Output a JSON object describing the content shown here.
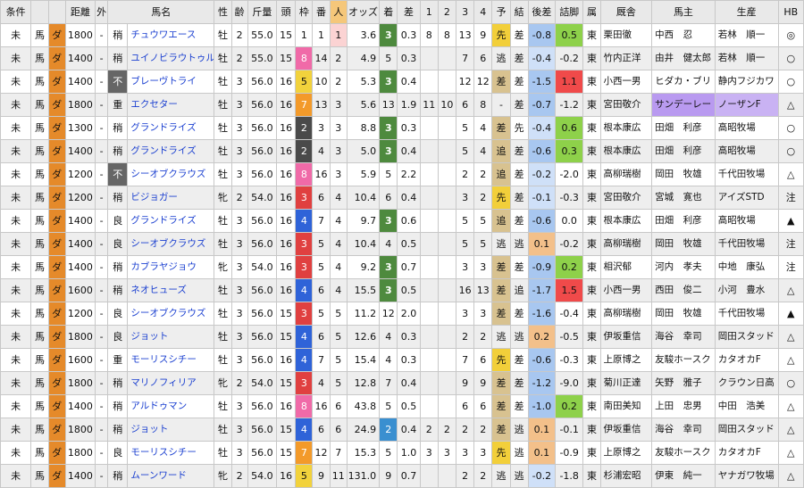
{
  "headers": [
    "条件",
    "",
    "",
    "距離",
    "外",
    "馬名",
    "性",
    "齢",
    "斤量",
    "頭",
    "枠",
    "番",
    "人",
    "オッズ",
    "着",
    "差",
    "1",
    "2",
    "3",
    "4",
    "予",
    "結",
    "後差",
    "詰脚",
    "属",
    "厩舎",
    "馬主",
    "生産",
    "HB"
  ],
  "rows": [
    [
      "未",
      "馬",
      "ダ",
      "1800",
      "-",
      "稍",
      "チュウワエース",
      "牡",
      "2",
      "55.0",
      "15",
      "1",
      "1",
      "1",
      "3.6",
      "3",
      "0.3",
      "8",
      "8",
      "13",
      "9",
      "先",
      "差",
      "-0.8",
      "0.5",
      "東",
      "栗田徹",
      "中西　忍",
      "若林　順一",
      "◎"
    ],
    [
      "未",
      "馬",
      "ダ",
      "1400",
      "-",
      "稍",
      "ユイノビラウトゥル",
      "牡",
      "2",
      "55.0",
      "15",
      "8",
      "14",
      "2",
      "4.9",
      "5",
      "0.3",
      "",
      "",
      "7",
      "6",
      "逃",
      "差",
      "-0.4",
      "-0.2",
      "東",
      "竹内正洋",
      "由井　健太郎",
      "若林　順一",
      "○"
    ],
    [
      "未",
      "馬",
      "ダ",
      "1400",
      "-",
      "不",
      "ブレーヴトライ",
      "牡",
      "3",
      "56.0",
      "16",
      "5",
      "10",
      "2",
      "5.3",
      "3",
      "0.4",
      "",
      "",
      "12",
      "12",
      "差",
      "差",
      "-1.5",
      "1.1",
      "東",
      "小西一男",
      "ヒダカ・ブリ",
      "静内フジカワ",
      "○"
    ],
    [
      "未",
      "馬",
      "ダ",
      "1800",
      "-",
      "重",
      "エクセター",
      "牡",
      "3",
      "56.0",
      "16",
      "7",
      "13",
      "3",
      "5.6",
      "13",
      "1.9",
      "11",
      "10",
      "6",
      "8",
      "-",
      "差",
      "-0.7",
      "-1.2",
      "東",
      "宮田敬介",
      "サンデーレー",
      "ノーザンF",
      "△"
    ],
    [
      "未",
      "馬",
      "ダ",
      "1300",
      "-",
      "稍",
      "グランドライズ",
      "牡",
      "3",
      "56.0",
      "16",
      "2",
      "3",
      "3",
      "8.8",
      "3",
      "0.3",
      "",
      "",
      "5",
      "4",
      "差",
      "先",
      "-0.4",
      "0.6",
      "東",
      "根本康広",
      "田畑　利彦",
      "高昭牧場",
      "○"
    ],
    [
      "未",
      "馬",
      "ダ",
      "1400",
      "-",
      "稍",
      "グランドライズ",
      "牡",
      "3",
      "56.0",
      "16",
      "2",
      "4",
      "3",
      "5.0",
      "3",
      "0.4",
      "",
      "",
      "5",
      "4",
      "追",
      "差",
      "-0.6",
      "0.3",
      "東",
      "根本康広",
      "田畑　利彦",
      "高昭牧場",
      "○"
    ],
    [
      "未",
      "馬",
      "ダ",
      "1200",
      "-",
      "不",
      "シーオブクラウズ",
      "牡",
      "3",
      "56.0",
      "16",
      "8",
      "16",
      "3",
      "5.9",
      "5",
      "2.2",
      "",
      "",
      "2",
      "2",
      "追",
      "差",
      "-0.2",
      "-2.0",
      "東",
      "高柳瑞樹",
      "岡田　牧雄",
      "千代田牧場",
      "△"
    ],
    [
      "未",
      "馬",
      "ダ",
      "1200",
      "-",
      "稍",
      "ビジョガー",
      "牝",
      "2",
      "54.0",
      "16",
      "3",
      "6",
      "4",
      "10.4",
      "6",
      "0.4",
      "",
      "",
      "3",
      "2",
      "先",
      "差",
      "-0.1",
      "-0.3",
      "東",
      "宮田敬介",
      "宮城　寛也",
      "アイズSTD",
      "注"
    ],
    [
      "未",
      "馬",
      "ダ",
      "1400",
      "-",
      "良",
      "グランドライズ",
      "牡",
      "3",
      "56.0",
      "16",
      "4",
      "7",
      "4",
      "9.7",
      "3",
      "0.6",
      "",
      "",
      "5",
      "5",
      "追",
      "差",
      "-0.6",
      "0.0",
      "東",
      "根本康広",
      "田畑　利彦",
      "高昭牧場",
      "▲"
    ],
    [
      "未",
      "馬",
      "ダ",
      "1400",
      "-",
      "良",
      "シーオブクラウズ",
      "牡",
      "3",
      "56.0",
      "16",
      "3",
      "5",
      "4",
      "10.4",
      "4",
      "0.5",
      "",
      "",
      "5",
      "5",
      "逃",
      "逃",
      "0.1",
      "-0.2",
      "東",
      "高柳瑞樹",
      "岡田　牧雄",
      "千代田牧場",
      "注"
    ],
    [
      "未",
      "馬",
      "ダ",
      "1400",
      "-",
      "稍",
      "カブラヤジョウ",
      "牝",
      "3",
      "54.0",
      "16",
      "3",
      "5",
      "4",
      "9.2",
      "3",
      "0.7",
      "",
      "",
      "3",
      "3",
      "差",
      "差",
      "-0.9",
      "0.2",
      "東",
      "相沢郁",
      "河内　孝夫",
      "中地　康弘",
      "注"
    ],
    [
      "未",
      "馬",
      "ダ",
      "1600",
      "-",
      "稍",
      "ネオヒューズ",
      "牡",
      "3",
      "56.0",
      "16",
      "4",
      "6",
      "4",
      "15.5",
      "3",
      "0.5",
      "",
      "",
      "16",
      "13",
      "差",
      "追",
      "-1.7",
      "1.5",
      "東",
      "小西一男",
      "西田　俊二",
      "小河　豊水",
      "△"
    ],
    [
      "未",
      "馬",
      "ダ",
      "1200",
      "-",
      "良",
      "シーオブクラウズ",
      "牡",
      "3",
      "56.0",
      "15",
      "3",
      "5",
      "5",
      "11.2",
      "12",
      "2.0",
      "",
      "",
      "3",
      "3",
      "差",
      "差",
      "-1.6",
      "-0.4",
      "東",
      "高柳瑞樹",
      "岡田　牧雄",
      "千代田牧場",
      "▲"
    ],
    [
      "未",
      "馬",
      "ダ",
      "1800",
      "-",
      "良",
      "ジョット",
      "牡",
      "3",
      "56.0",
      "15",
      "4",
      "6",
      "5",
      "12.6",
      "4",
      "0.3",
      "",
      "",
      "2",
      "2",
      "逃",
      "逃",
      "0.2",
      "-0.5",
      "東",
      "伊坂重信",
      "海谷　幸司",
      "岡田スタッド",
      "△"
    ],
    [
      "未",
      "馬",
      "ダ",
      "1600",
      "-",
      "重",
      "モーリスシチー",
      "牡",
      "3",
      "56.0",
      "16",
      "4",
      "7",
      "5",
      "15.4",
      "4",
      "0.3",
      "",
      "",
      "7",
      "6",
      "先",
      "差",
      "-0.6",
      "-0.3",
      "東",
      "上原博之",
      "友駿ホースク",
      "カタオカF",
      "△"
    ],
    [
      "未",
      "馬",
      "ダ",
      "1800",
      "-",
      "稍",
      "マリノフィリア",
      "牝",
      "2",
      "54.0",
      "15",
      "3",
      "4",
      "5",
      "12.8",
      "7",
      "0.4",
      "",
      "",
      "9",
      "9",
      "差",
      "差",
      "-1.2",
      "-9.0",
      "東",
      "菊川正達",
      "矢野　雅子",
      "クラウン日高",
      "○"
    ],
    [
      "未",
      "馬",
      "ダ",
      "1400",
      "-",
      "稍",
      "アルドゥマン",
      "牡",
      "3",
      "56.0",
      "16",
      "8",
      "16",
      "6",
      "43.8",
      "5",
      "0.5",
      "",
      "",
      "6",
      "6",
      "差",
      "差",
      "-1.0",
      "0.2",
      "東",
      "南田美知",
      "上田　忠男",
      "中田　浩美",
      "△"
    ],
    [
      "未",
      "馬",
      "ダ",
      "1800",
      "-",
      "稍",
      "ジョット",
      "牡",
      "3",
      "56.0",
      "15",
      "4",
      "6",
      "6",
      "24.9",
      "2",
      "0.4",
      "2",
      "2",
      "2",
      "2",
      "差",
      "逃",
      "0.1",
      "-0.1",
      "東",
      "伊坂重信",
      "海谷　幸司",
      "岡田スタッド",
      "△"
    ],
    [
      "未",
      "馬",
      "ダ",
      "1800",
      "-",
      "良",
      "モーリスシチー",
      "牡",
      "3",
      "56.0",
      "15",
      "7",
      "12",
      "7",
      "15.3",
      "5",
      "1.0",
      "3",
      "3",
      "3",
      "3",
      "先",
      "逃",
      "0.1",
      "-0.9",
      "東",
      "上原博之",
      "友駿ホースク",
      "カタオカF",
      "△"
    ],
    [
      "未",
      "馬",
      "ダ",
      "1400",
      "-",
      "稍",
      "ムーンワード",
      "牝",
      "2",
      "54.0",
      "16",
      "5",
      "9",
      "11",
      "131.0",
      "9",
      "0.7",
      "",
      "",
      "2",
      "2",
      "逃",
      "逃",
      "-0.2",
      "-1.8",
      "東",
      "杉浦宏昭",
      "伊東　純一",
      "ヤナガワ牧場",
      "△"
    ]
  ],
  "colors": {
    "header_bg": "#e9e9e9",
    "horse_name": "#1a3fd0",
    "course_orange": "#e58a2a",
    "accent_red": "#d42020"
  }
}
